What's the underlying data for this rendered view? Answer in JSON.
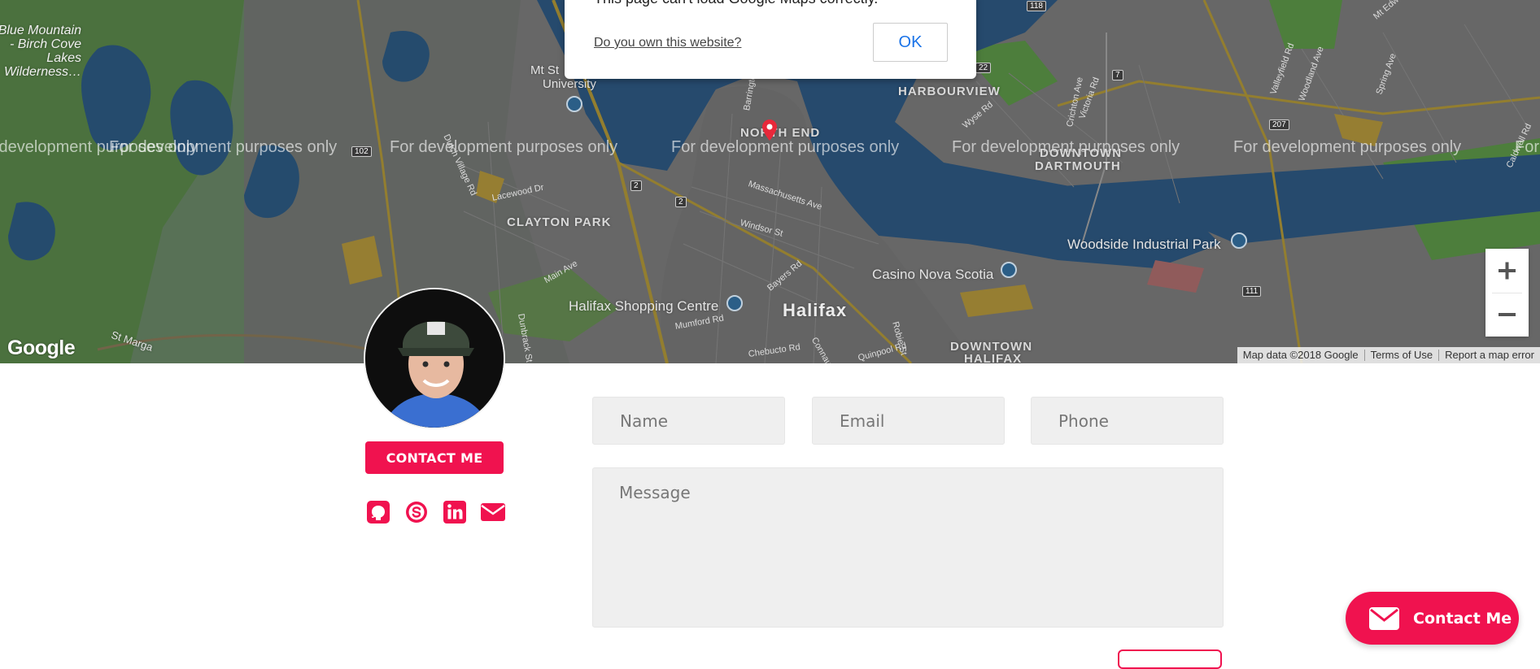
{
  "map": {
    "dialog": {
      "message": "This page can't load Google Maps correctly.",
      "own_link": "Do you own this website?",
      "ok_label": "OK"
    },
    "dev_watermark": "For development purposes only",
    "places": {
      "blue_mountain": "Blue Mountain - Birch Cove Lakes Wilderness…",
      "mt_st_u": "Mt St",
      "university": "University",
      "harbourview": "HARBOURVIEW",
      "north_end": "NORTH END",
      "downtown_dartmouth_1": "DOWNTOWN",
      "downtown_dartmouth_2": "DARTMOUTH",
      "clayton_park": "CLAYTON PARK",
      "woodside": "Woodside Industrial Park",
      "casino": "Casino Nova Scotia",
      "halifax_shopping": "Halifax Shopping Centre",
      "halifax": "Halifax",
      "downtown_halifax_1": "DOWNTOWN",
      "downtown_halifax_2": "HALIFAX",
      "st_margarets": "St Marga"
    },
    "roads": {
      "barrington": "Barrington St",
      "massachusetts": "Massachusetts Ave",
      "windsor": "Windsor St",
      "main_ave": "Main Ave",
      "lacewood": "Lacewood Dr",
      "bayers": "Bayers Rd",
      "mumford": "Mumford Rd",
      "chebucto": "Chebucto Rd",
      "robie": "Robie St",
      "quinpool": "Quinpool Rd",
      "connaught": "Connaught",
      "wyse": "Wyse Rd",
      "victoria": "Victoria Rd",
      "valleyfield": "Valleyfield Rd",
      "woodland": "Woodland Ave",
      "spring": "Spring Ave",
      "dunbrack": "Dunbrack St",
      "dutch_village": "Dutch Village Rd",
      "caldwell": "Caldwell Rd",
      "crichton": "Crichton Ave",
      "mt_edward": "Mt Edw"
    },
    "shields": [
      "118",
      "22",
      "7",
      "207",
      "102",
      "2",
      "2",
      "111"
    ],
    "google_logo": "Google",
    "attribution": [
      "Map data ©2018 Google",
      "Terms of Use",
      "Report a map error"
    ]
  },
  "profile": {
    "contact_button": "CONTACT ME",
    "socials": [
      "github-icon",
      "skype-icon",
      "linkedin-icon",
      "envelope-icon"
    ]
  },
  "form": {
    "name_placeholder": "Name",
    "email_placeholder": "Email",
    "phone_placeholder": "Phone",
    "message_placeholder": "Message"
  },
  "fab": {
    "label": "Contact Me"
  },
  "colors": {
    "accent": "#f0124f",
    "field_bg": "#efefef"
  }
}
